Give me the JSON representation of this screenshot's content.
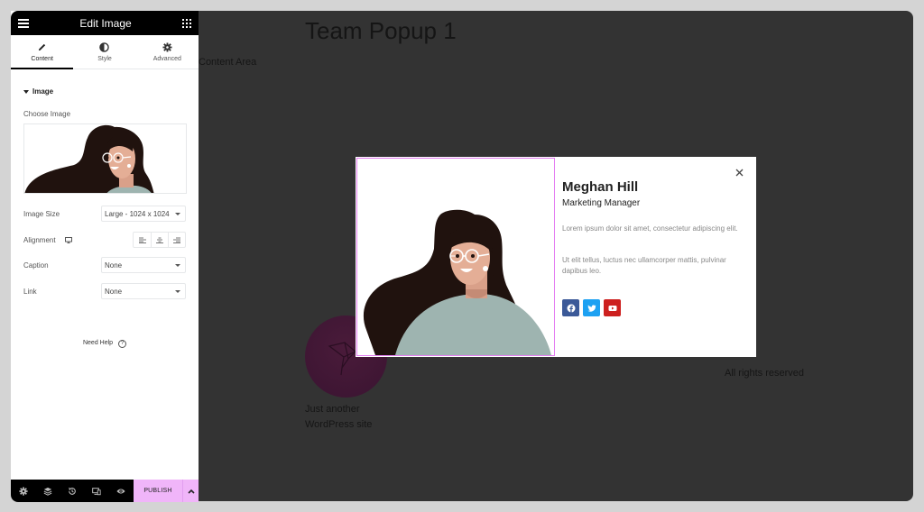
{
  "panel": {
    "title": "Edit Image",
    "tabs": [
      {
        "label": "Content",
        "icon": "pencil-icon",
        "active": true
      },
      {
        "label": "Style",
        "icon": "half-circle-icon",
        "active": false
      },
      {
        "label": "Advanced",
        "icon": "gear-icon",
        "active": false
      }
    ],
    "section_title": "Image",
    "choose_image_label": "Choose Image",
    "controls": {
      "image_size": {
        "label": "Image Size",
        "value": "Large - 1024 x 1024"
      },
      "alignment": {
        "label": "Alignment",
        "options": [
          "left",
          "center",
          "right"
        ]
      },
      "caption": {
        "label": "Caption",
        "value": "None"
      },
      "link": {
        "label": "Link",
        "value": "None"
      }
    },
    "need_help": "Need Help",
    "help_icon": "?",
    "footer": {
      "icons": [
        "gear-icon",
        "layers-icon",
        "history-icon",
        "responsive-icon",
        "eye-icon"
      ],
      "publish_label": "PUBLISH"
    }
  },
  "canvas": {
    "page_title": "Team Popup 1",
    "content_area": "Content Area",
    "tagline": "Just another WordPress site",
    "copyright": "All rights reserved"
  },
  "popup": {
    "name": "Meghan Hill",
    "role": "Marketing Manager",
    "bio": [
      "Lorem ipsum dolor sit amet, consectetur adipiscing elit.",
      "Ut elit tellus, luctus nec ullamcorper mattis, pulvinar dapibus leo."
    ],
    "social": [
      {
        "name": "facebook",
        "color": "#3b5998"
      },
      {
        "name": "twitter",
        "color": "#1da1f2"
      },
      {
        "name": "youtube",
        "color": "#cd201f"
      }
    ]
  },
  "colors": {
    "accent": "#f0b5f9",
    "image_border": "#e47ef2",
    "canvas_bg": "#333333"
  }
}
